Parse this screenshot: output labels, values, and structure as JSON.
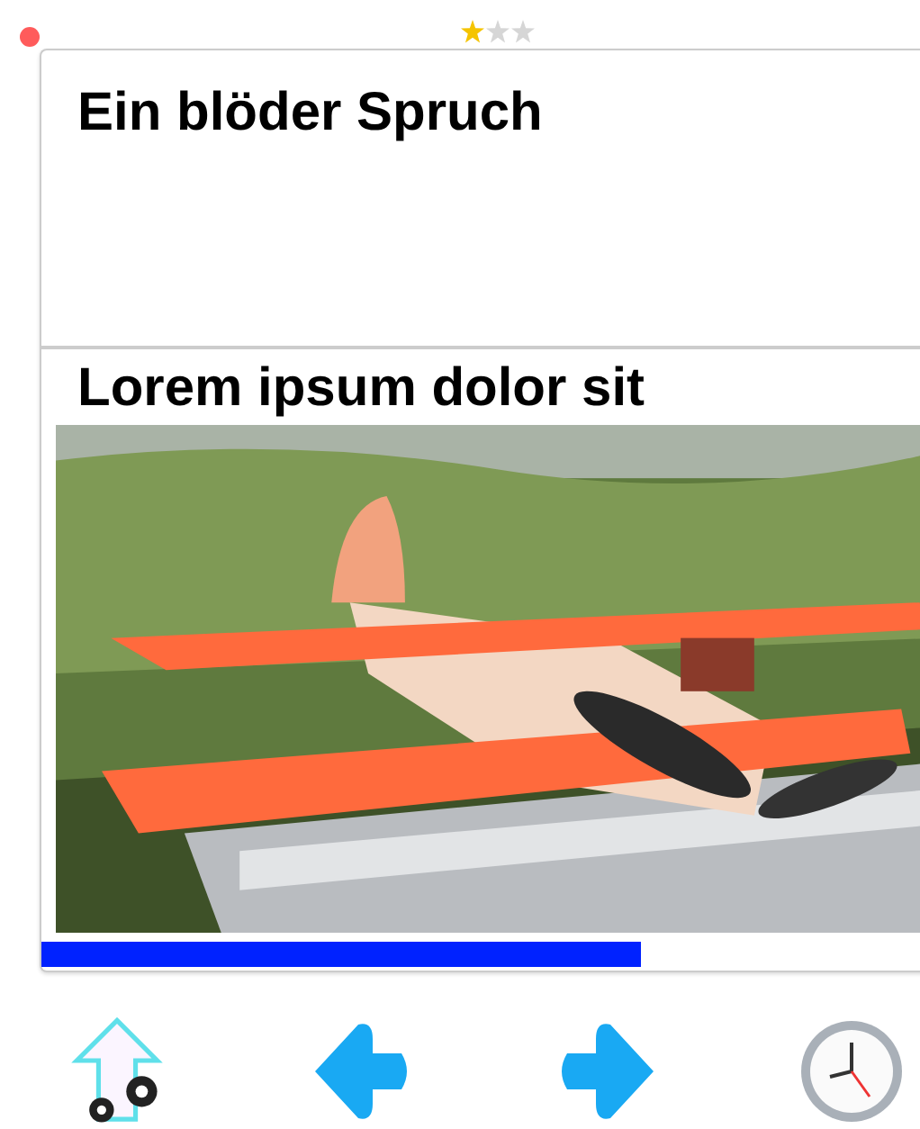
{
  "rating": {
    "stars": 1
  },
  "card": {
    "title": "Ein blöder Spruch",
    "subtitle": "Lorem ipsum dolor sit",
    "progress": {
      "level": 0.64
    }
  },
  "toolbar": [
    {
      "kind": "share-settings"
    },
    {
      "kind": "back"
    },
    {
      "kind": "forward"
    },
    {
      "kind": "clock"
    }
  ]
}
